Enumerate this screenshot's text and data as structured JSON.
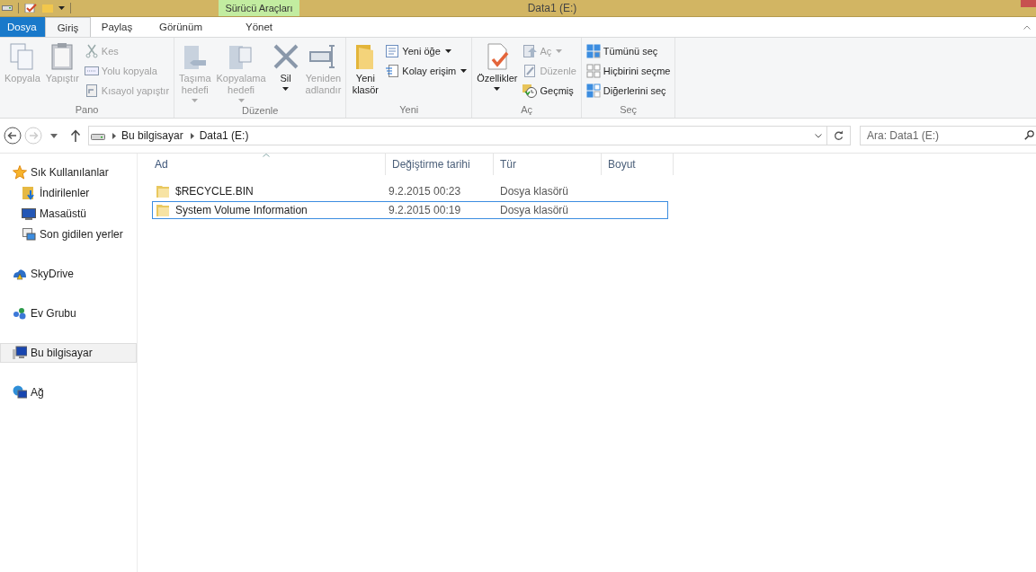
{
  "window": {
    "title": "Data1 (E:)",
    "context_tab_group": "Sürücü Araçları"
  },
  "tabs": [
    {
      "label": "Dosya",
      "kind": "file",
      "selected": false
    },
    {
      "label": "Giriş",
      "kind": "tab",
      "selected": true
    },
    {
      "label": "Paylaş",
      "kind": "tab",
      "selected": false
    },
    {
      "label": "Görünüm",
      "kind": "tab",
      "selected": false
    },
    {
      "label": "Yönet",
      "kind": "context",
      "selected": false
    }
  ],
  "ribbon": [
    {
      "name": "Pano",
      "columns": [
        {
          "kind": "large",
          "label": "Kopyala",
          "disabled": true,
          "dropdown": false
        },
        {
          "kind": "large",
          "label": "Yapıştır",
          "disabled": true,
          "dropdown": false
        },
        {
          "kind": "stack",
          "items": [
            {
              "label": "Kes",
              "disabled": true,
              "dropdown": false
            },
            {
              "label": "Yolu kopyala",
              "disabled": true,
              "dropdown": false
            },
            {
              "label": "Kısayol yapıştır",
              "disabled": true,
              "dropdown": false
            }
          ]
        }
      ]
    },
    {
      "name": "Düzenle",
      "columns": [
        {
          "kind": "large",
          "label": "Taşıma\nhedefi",
          "disabled": true,
          "dropdown": true
        },
        {
          "kind": "large",
          "label": "Kopyalama\nhedefi",
          "disabled": true,
          "dropdown": true
        },
        {
          "kind": "large",
          "label": "Sil",
          "disabled": false,
          "dropdown": true
        },
        {
          "kind": "large",
          "label": "Yeniden\nadlandır",
          "disabled": true,
          "dropdown": false
        }
      ]
    },
    {
      "name": "Yeni",
      "columns": [
        {
          "kind": "large",
          "label": "Yeni\nklasör",
          "disabled": false,
          "dropdown": false
        },
        {
          "kind": "stack",
          "items": [
            {
              "label": "Yeni öğe",
              "disabled": false,
              "dropdown": true
            },
            {
              "label": "Kolay erişim",
              "disabled": false,
              "dropdown": true
            }
          ]
        }
      ]
    },
    {
      "name": "Aç",
      "columns": [
        {
          "kind": "large",
          "label": "Özellikler",
          "disabled": false,
          "dropdown": true
        },
        {
          "kind": "stack",
          "items": [
            {
              "label": "Aç",
              "disabled": true,
              "dropdown": true
            },
            {
              "label": "Düzenle",
              "disabled": true,
              "dropdown": false
            },
            {
              "label": "Geçmiş",
              "disabled": false,
              "dropdown": false
            }
          ]
        }
      ]
    },
    {
      "name": "Seç",
      "columns": [
        {
          "kind": "stack",
          "items": [
            {
              "label": "Tümünü seç",
              "disabled": false,
              "dropdown": false
            },
            {
              "label": "Hiçbirini seçme",
              "disabled": false,
              "dropdown": false
            },
            {
              "label": "Diğerlerini seç",
              "disabled": false,
              "dropdown": false
            }
          ]
        }
      ]
    }
  ],
  "address_bar": {
    "back_disabled": false,
    "forward_disabled": true,
    "crumbs": [
      "Bu bilgisayar",
      "Data1 (E:)"
    ]
  },
  "search": {
    "placeholder": "Ara: Data1 (E:)"
  },
  "sidebar": {
    "items": [
      {
        "label": "Sık Kullanılanlar",
        "selected": false,
        "children": [
          {
            "label": "İndirilenler",
            "selected": false
          },
          {
            "label": "Masaüstü",
            "selected": false
          },
          {
            "label": "Son gidilen yerler",
            "selected": false
          }
        ]
      },
      {
        "label": "SkyDrive",
        "selected": false
      },
      {
        "label": "Ev Grubu",
        "selected": false
      },
      {
        "label": "Bu bilgisayar",
        "selected": true
      },
      {
        "label": "Ağ",
        "selected": false
      }
    ]
  },
  "table": {
    "columns": [
      {
        "label": "Ad",
        "sorted": true
      },
      {
        "label": "Değiştirme tarihi",
        "sorted": false
      },
      {
        "label": "Tür",
        "sorted": false
      },
      {
        "label": "Boyut",
        "sorted": false
      }
    ],
    "rows": [
      {
        "name": "$RECYCLE.BIN",
        "date": "9.2.2015 00:23",
        "type": "Dosya klasörü",
        "focused": false
      },
      {
        "name": "System Volume Information",
        "date": "9.2.2015 00:19",
        "type": "Dosya klasörü",
        "focused": true
      }
    ]
  }
}
